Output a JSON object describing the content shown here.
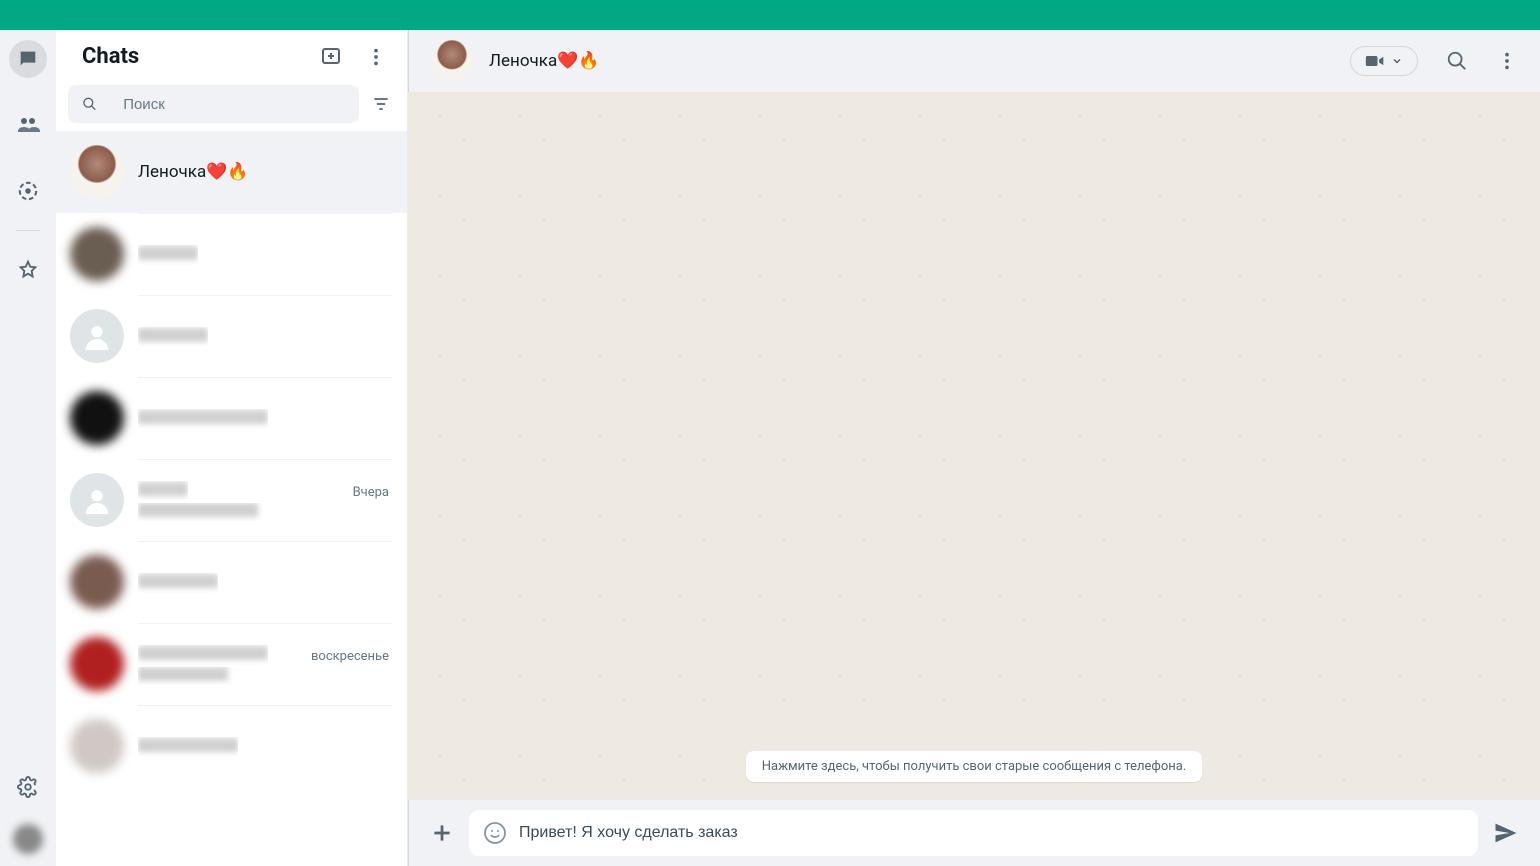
{
  "sidebar": {
    "title": "Chats",
    "search_placeholder": "Поиск"
  },
  "active_chat": {
    "name": "Леночка❤️🔥"
  },
  "chat_list": [
    {
      "name": "Леночка❤️🔥",
      "time": "",
      "preview": "",
      "active": true,
      "blurred": false
    },
    {
      "name": "",
      "time": "",
      "preview": "",
      "active": false,
      "blurred": true
    },
    {
      "name": "",
      "time": "",
      "preview": "",
      "active": false,
      "blurred": true
    },
    {
      "name": "",
      "time": "",
      "preview": "",
      "active": false,
      "blurred": true
    },
    {
      "name": "",
      "time": "Вчера",
      "preview": "",
      "active": false,
      "blurred": true
    },
    {
      "name": "",
      "time": "",
      "preview": "",
      "active": false,
      "blurred": true
    },
    {
      "name": "",
      "time": "воскресенье",
      "preview": "",
      "active": false,
      "blurred": true
    },
    {
      "name": "",
      "time": "",
      "preview": "",
      "active": false,
      "blurred": true
    }
  ],
  "conversation": {
    "system_message": "Нажмите здесь, чтобы получить свои старые сообщения с телефона."
  },
  "composer": {
    "input_value": "Привет! Я хочу сделать заказ"
  }
}
